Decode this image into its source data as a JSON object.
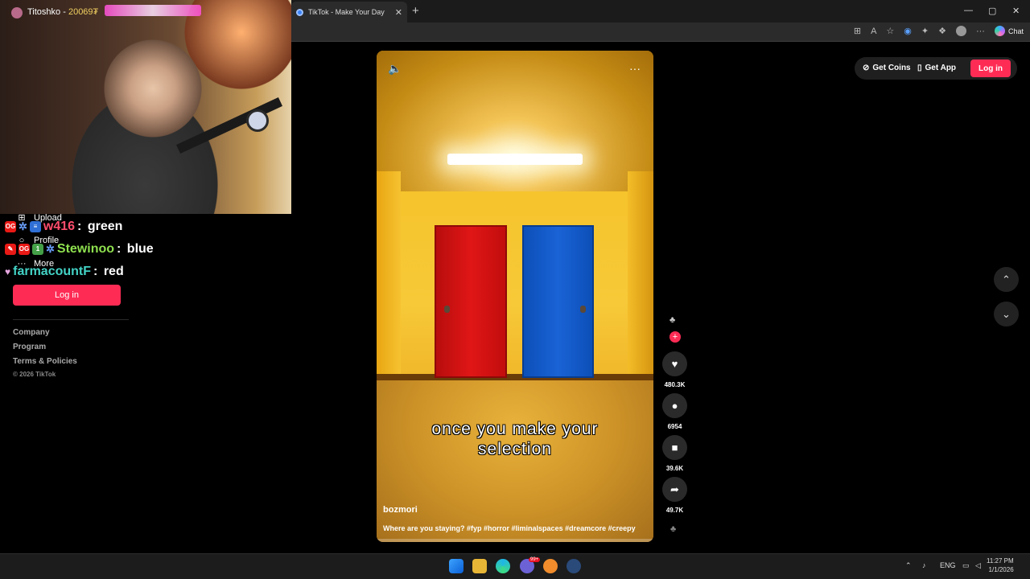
{
  "browser": {
    "tab_title": "TikTok - Make Your Day",
    "tab_close": "✕",
    "new_tab": "+",
    "window_controls": [
      "—",
      "▢",
      "✕"
    ],
    "toolbar_icons": [
      "apps-icon",
      "read-aloud-icon",
      "favorite-icon",
      "extension-icon",
      "puzzle-icon",
      "collections-icon",
      "profile-icon",
      "more-icon"
    ],
    "chat_label": "Chat"
  },
  "stream": {
    "streamer_name": "Titoshko",
    "streamer_points": "20069₮",
    "chat": [
      {
        "user": "w416",
        "user_color": "#ff4d6d",
        "message": "green"
      },
      {
        "user": "Stewinoo",
        "user_color": "#8ee04f",
        "message": "blue"
      },
      {
        "user": "farmacountF",
        "user_color": "#43d3c6",
        "message": "red"
      }
    ]
  },
  "sidebar": {
    "items": [
      {
        "label": "Upload",
        "icon": "upload-icon"
      },
      {
        "label": "Profile",
        "icon": "profile-icon"
      },
      {
        "label": "More",
        "icon": "more-icon"
      }
    ],
    "login_label": "Log in",
    "footer": {
      "links": [
        "Company",
        "Program",
        "Terms & Policies"
      ],
      "copyright": "© 2026 TikTok"
    }
  },
  "video": {
    "caption_line1": "once you make your",
    "caption_line2": "selection",
    "author": "bozmori",
    "description": "Where are you staying? #fyp #horror #liminalspaces #dreamcore #creepy"
  },
  "actions": {
    "likes": "480.3K",
    "comments": "6954",
    "saves": "39.6K",
    "shares": "49.7K"
  },
  "topbar": {
    "get_coins": "Get Coins",
    "get_app": "Get App",
    "login": "Log in"
  },
  "taskbar": {
    "language": "ENG",
    "time": "11:27 PM",
    "date": "1/1/2026",
    "badge_count": "99+"
  },
  "colors": {
    "accent": "#fe2c55",
    "red_door": "#e01616",
    "blue_door": "#1a63d6"
  }
}
